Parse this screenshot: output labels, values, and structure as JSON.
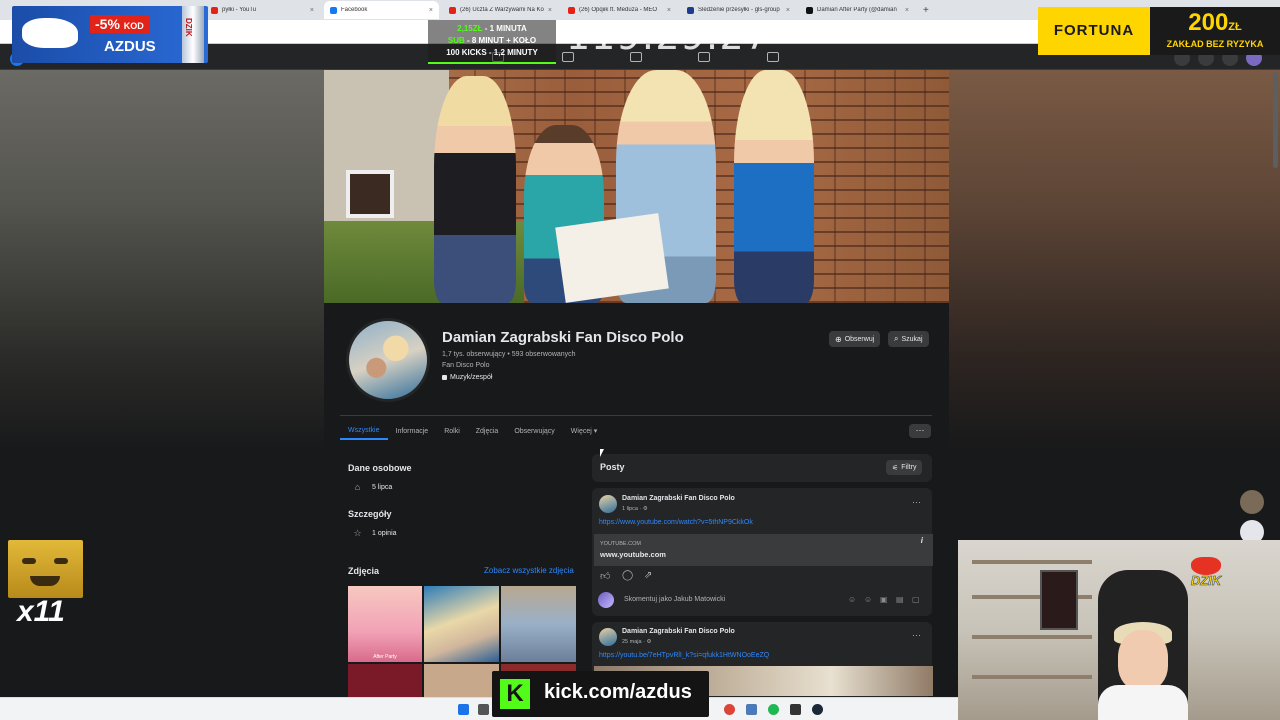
{
  "browser": {
    "tabs": [
      {
        "label": "pyłki - YouTu",
        "favicon_color": "#e62117",
        "active": false
      },
      {
        "label": "Facebook",
        "favicon_color": "#1877f2",
        "active": true
      },
      {
        "label": "(26) Uczta Z Warzywami Na Ko",
        "favicon_color": "#e62117",
        "active": false
      },
      {
        "label": "(26) Opqiik ft. Meduza - MEO",
        "favicon_color": "#e62117",
        "active": false
      },
      {
        "label": "Śledzenie przesyłki - gls-group",
        "favicon_color": "#1c3d8c",
        "active": false
      },
      {
        "label": "Damian After Party (@damian",
        "favicon_color": "#111111",
        "active": false
      }
    ],
    "new_tab": "+",
    "close": "×"
  },
  "page": {
    "name": "Damian Zagrabski Fan Disco Polo",
    "stats": "1,7 tys. obserwujący • 593 obserwowanych",
    "subtitle": "Fan Disco Polo",
    "category": "Muzyk/zespół",
    "follow_button": "Obserwuj",
    "search_button": "Szukaj",
    "tabs": [
      "Wszystkie",
      "Informacje",
      "Rolki",
      "Zdjęcia",
      "Obserwujący",
      "Więcej ▾"
    ],
    "more": "···"
  },
  "left": {
    "personal_title": "Dane osobowe",
    "birthday": "5 lipca",
    "details_title": "Szczegóły",
    "reviews": "1 opinia",
    "photos_title": "Zdjęcia",
    "see_all_photos": "Zobacz wszystkie zdjęcia",
    "photo_caption": "After Party"
  },
  "feed": {
    "title": "Posty",
    "filters": "Filtry",
    "posts": [
      {
        "author": "Damian Zagrabski Fan Disco Polo",
        "date": "1 lipca · ⚙",
        "link": "https://www.youtube.com/watch?v=5thNP9CkkOk",
        "preview_domain": "YOUTUBE.COM",
        "preview_site": "www.youtube.com"
      },
      {
        "author": "Damian Zagrabski Fan Disco Polo",
        "date": "25 maja · ⚙",
        "link": "https://youtu.be/7eHTpvRlI_k?si=qfukk1HtWNOoEeZQ"
      }
    ],
    "comment_placeholder": "Skomentuj jako Jakub Matowicki",
    "menu": "···",
    "info": "i"
  },
  "overlays": {
    "dzik_discount": "-5%",
    "dzik_kod": "KOD",
    "dzik_code": "AZDUS",
    "dzik_can": "DZIK",
    "sub_line1_price": "2,15ZŁ",
    "sub_line1_rest": " - 1 MINUTA",
    "sub_line2_price": "SUB",
    "sub_line2_rest": " - 8 MINUT + KOŁO",
    "sub_line3": "100 KICKS - 1,2 MINUTY",
    "timer": "119:29:27",
    "fortuna_brand": "FORTUNA",
    "fortuna_amount": "200",
    "fortuna_currency": "ZŁ",
    "fortuna_tagline": "ZAKŁAD BEZ RYZYKA",
    "emote_count": "x11",
    "kick_url": "kick.com/azdus",
    "kick_logo": "K",
    "webcam_logo": "DZIK"
  },
  "colors": {
    "facebook_blue": "#2d88ff",
    "kick_green": "#53fc18",
    "fortuna_yellow": "#ffd500",
    "page_bg": "#18191a",
    "card_bg": "#242526"
  },
  "icons": {
    "follow": "follow-icon",
    "search": "search-icon",
    "birthday": "cake-icon",
    "reviews": "star-icon",
    "filters": "filter-icon",
    "like": "like-icon",
    "comment": "comment-icon",
    "share": "share-icon"
  }
}
